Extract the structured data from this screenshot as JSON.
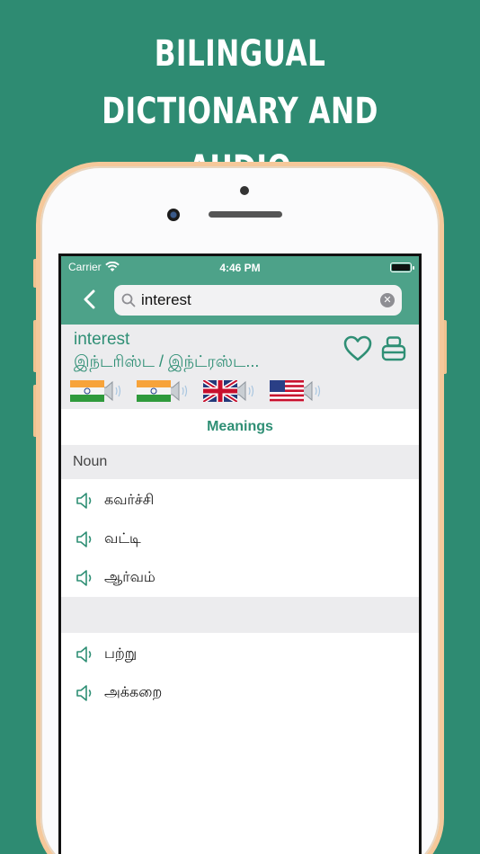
{
  "headline": {
    "line1": "BILINGUAL DICTIONARY AND",
    "line2": "AUDIO PRONUNCIATION"
  },
  "status_bar": {
    "carrier": "Carrier",
    "time": "4:46 PM"
  },
  "search": {
    "query": "interest"
  },
  "entry": {
    "word": "interest",
    "transliteration": "இந்டரிஸ்ட / இந்ட்ரஸ்ட..."
  },
  "flags": [
    {
      "name": "india-flag",
      "country": "India"
    },
    {
      "name": "india-flag",
      "country": "India"
    },
    {
      "name": "uk-flag",
      "country": "United Kingdom"
    },
    {
      "name": "usa-flag",
      "country": "United States"
    }
  ],
  "meanings": {
    "title": "Meanings",
    "groups": [
      {
        "label": "Noun",
        "items": [
          "கவர்ச்சி",
          "வட்டி",
          "ஆர்வம்"
        ]
      },
      {
        "label": "",
        "items": [
          "பற்று",
          "அக்கறை"
        ]
      }
    ]
  },
  "colors": {
    "background": "#2e8b72",
    "navbar": "#4da289",
    "accent": "#2f8f75",
    "phone_frame": "#f5c89a"
  }
}
